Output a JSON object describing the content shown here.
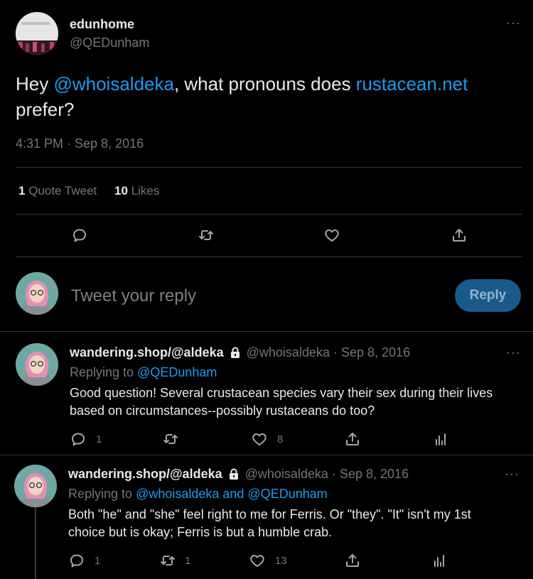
{
  "main_tweet": {
    "display_name": "edunhome",
    "handle": "@QEDunham",
    "text_part1": "Hey ",
    "mention": "@whoisaldeka",
    "text_part2": ", what pronouns does ",
    "link": "rustacean.net",
    "text_part3": "prefer?",
    "timestamp": "4:31 PM · Sep 8, 2016",
    "stats": {
      "quote_count": "1",
      "quote_label": "Quote Tweet",
      "like_count": "10",
      "like_label": "Likes"
    }
  },
  "composer": {
    "placeholder": "Tweet your reply",
    "reply_label": "Reply"
  },
  "replies": [
    {
      "display_name": "wandering.shop/@aldeka",
      "handle": "@whoisaldeka",
      "date": "· Sep 8, 2016",
      "replying_prefix": "Replying to",
      "replying_to": "@QEDunham",
      "text": "Good question! Several crustacean species vary their sex during their lives based on circumstances--possibly rustaceans do too?",
      "reply_count": "1",
      "retweet_count": "",
      "like_count": "8"
    },
    {
      "display_name": "wandering.shop/@aldeka",
      "handle": "@whoisaldeka",
      "date": "· Sep 8, 2016",
      "replying_prefix": "Replying to",
      "replying_to": "@whoisaldeka and @QEDunham",
      "text": "Both \"he\" and \"she\" feel right to me for Ferris. Or \"they\". \"It\" isn't my 1st choice but is okay; Ferris is but a humble crab.",
      "reply_count": "1",
      "retweet_count": "1",
      "like_count": "13"
    }
  ],
  "icons": [
    "more-icon",
    "reply-icon",
    "retweet-icon",
    "like-icon",
    "share-icon",
    "analytics-icon",
    "lock-icon"
  ],
  "colors": {
    "accent": "#1d9bf0",
    "muted": "#71767b",
    "background": "#000000"
  }
}
